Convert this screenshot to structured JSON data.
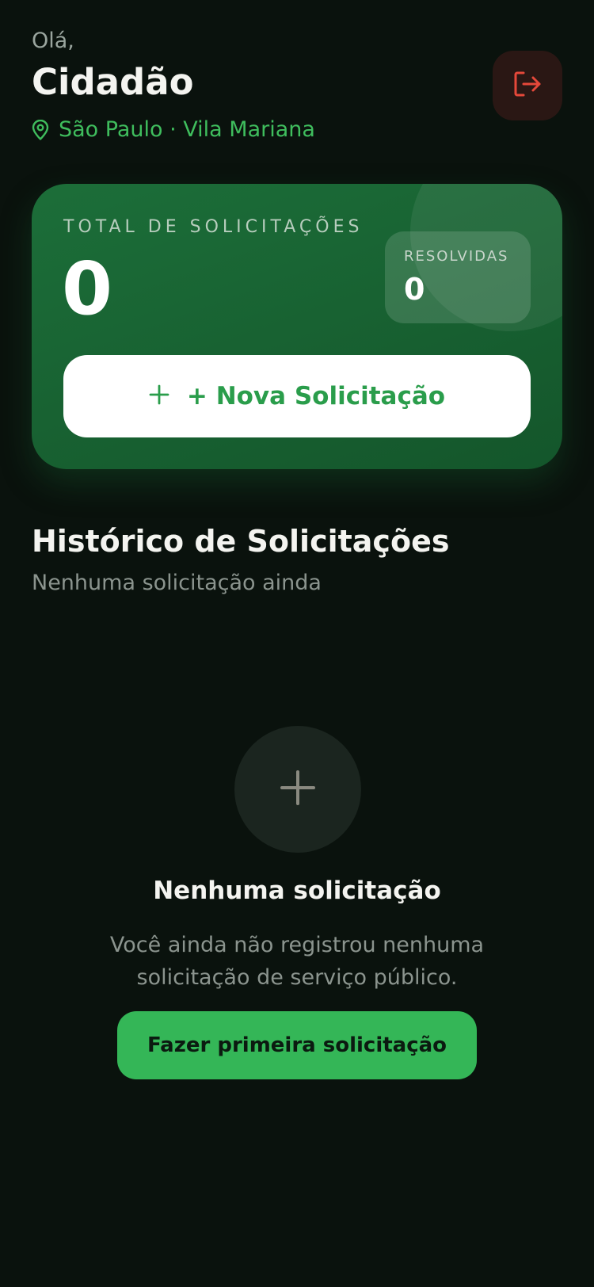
{
  "header": {
    "greeting": "Olá,",
    "user_name": "Cidadão",
    "location": "São Paulo · Vila Mariana",
    "location_icon": "map-pin-icon",
    "logout_icon": "logout-icon"
  },
  "summary": {
    "total_label": "TOTAL DE SOLICITAÇÕES",
    "total_value": "0",
    "resolved_label": "RESOLVIDAS",
    "resolved_value": "0",
    "new_request_icon": "plus-icon",
    "new_request_label": "+ Nova Solicitação"
  },
  "history": {
    "title": "Histórico de Solicitações",
    "subtitle": "Nenhuma solicitação ainda"
  },
  "empty_state": {
    "icon": "plus-icon",
    "title": "Nenhuma solicitação",
    "description": "Você ainda não registrou nenhuma solicitação de serviço público.",
    "button_label": "Fazer primeira solicitação"
  },
  "colors": {
    "background": "#0a120d",
    "accent_green": "#34b657",
    "card_green": "#1c6e39",
    "logout_red": "#e5483a"
  }
}
